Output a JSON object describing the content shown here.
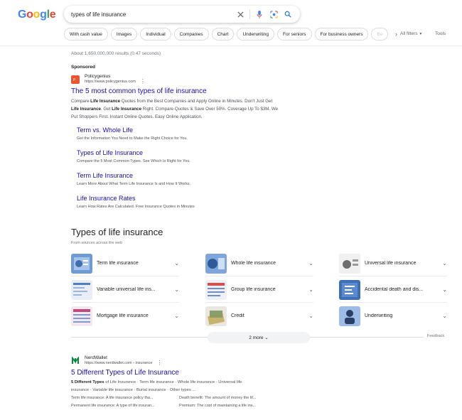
{
  "header": {
    "logo": [
      "G",
      "o",
      "o",
      "g",
      "l",
      "e"
    ],
    "logo_colors": [
      "#4285F4",
      "#EA4335",
      "#FBBC05",
      "#4285F4",
      "#34A853",
      "#EA4335"
    ],
    "query": "types of life insurance",
    "chips": [
      "With cash value",
      "Images",
      "Individual",
      "Companies",
      "Chart",
      "Underwriting",
      "For seniors",
      "For business owners",
      "Be"
    ],
    "all_filters": "All filters",
    "tools": "Tools"
  },
  "stats": "About 1,650,000,000 results (0.47 seconds)",
  "ad": {
    "sponsored": "Sponsored",
    "site_name": "Policygenius",
    "site_url": "https://www.policygenius.com",
    "title": "The 5 most common types of life insurance",
    "desc_parts": [
      "Compare ",
      "Life Insurance",
      " Quotes from the Best Companies and Apply Online in Minutes. Don't Just Get ",
      "Life Insurance",
      ". Get ",
      "Life Insurance",
      " Right. Compare Quotes & Save Over 50%. Coverage Up To $3M. We Put Shoppers First. Instant Online Quotes. Easy Online Application."
    ],
    "sitelinks": [
      {
        "title": "Term vs. Whole Life",
        "desc": "Get the Information You Need to Make the Right Choice for You."
      },
      {
        "title": "Types of Life Insurance",
        "desc": "Compare the 5 Most Common Types. See Which Is Right for You."
      },
      {
        "title": "Term Life Insurance",
        "desc": "Learn More About What Term Life Insurance Is and How It Works."
      },
      {
        "title": "Life Insurance Rates",
        "desc": "Learn How Rates Are Calculated. Free Insurance Quotes in Minutes"
      }
    ]
  },
  "types": {
    "title": "Types of life insurance",
    "subtitle": "From sources across the web",
    "items": [
      "Term life insurance",
      "Whole life insurance",
      "Universal life insurance",
      "Variable universal life ins...",
      "Group life insurance",
      "Accidental death and dis...",
      "Mortgage life insurance",
      "Credit",
      "Underwriting"
    ],
    "more": "2 more",
    "feedback": "Feedback"
  },
  "result": {
    "site_name": "NerdWallet",
    "site_url": "https://www.nerdwallet.com › insurance",
    "title": "5 Different Types of Life Insurance",
    "line1_bold": "5 Different Types",
    "line1_rest": " of Life Insurance · Term life insurance · Whole life insurance · Universal life",
    "line2": "insurance · Variable life insurance · Burial insurance · Other types ...",
    "pairs": [
      "Term life insurance: A life insurance policy tha...",
      "Death benefit: The amount of money the lif...",
      "Permanent life insurance: A type of life insuran...",
      "Premium: The cost of maintaining a life ins..."
    ]
  }
}
